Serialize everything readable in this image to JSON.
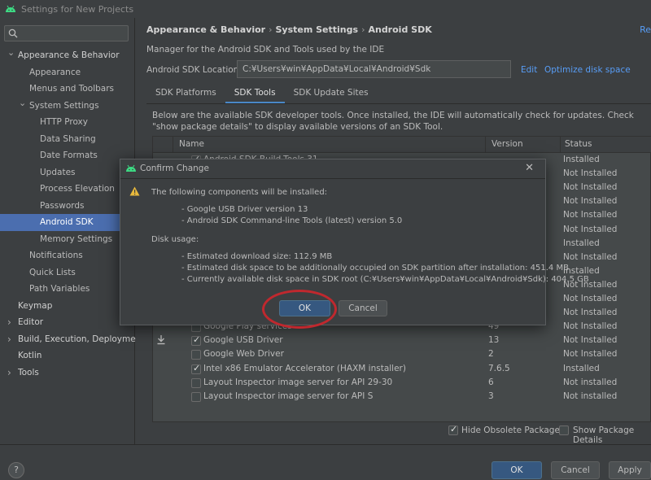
{
  "window": {
    "title": "Settings for New Projects"
  },
  "sidebar": {
    "search_placeholder": "",
    "items": [
      {
        "label": "Appearance & Behavior",
        "expanded": true
      },
      {
        "label": "Appearance"
      },
      {
        "label": "Menus and Toolbars"
      },
      {
        "label": "System Settings",
        "expanded": true
      },
      {
        "label": "HTTP Proxy"
      },
      {
        "label": "Data Sharing"
      },
      {
        "label": "Date Formats"
      },
      {
        "label": "Updates"
      },
      {
        "label": "Process Elevation"
      },
      {
        "label": "Passwords"
      },
      {
        "label": "Android SDK",
        "selected": true
      },
      {
        "label": "Memory Settings"
      },
      {
        "label": "Notifications"
      },
      {
        "label": "Quick Lists"
      },
      {
        "label": "Path Variables"
      },
      {
        "label": "Keymap"
      },
      {
        "label": "Editor",
        "expanded": false
      },
      {
        "label": "Build, Execution, Deployment",
        "expanded": false
      },
      {
        "label": "Kotlin"
      },
      {
        "label": "Tools",
        "expanded": false
      }
    ]
  },
  "main": {
    "breadcrumb": [
      "Appearance & Behavior",
      "System Settings",
      "Android SDK"
    ],
    "breadcrumb_sep": "›",
    "reset_label": "Re",
    "manager_text": "Manager for the Android SDK and Tools used by the IDE",
    "location_label": "Android SDK Location:",
    "location_value": "C:¥Users¥win¥AppData¥Local¥Android¥Sdk",
    "edit_label": "Edit",
    "optimize_label": "Optimize disk space",
    "tabs": [
      {
        "label": "SDK Platforms"
      },
      {
        "label": "SDK Tools",
        "active": true
      },
      {
        "label": "SDK Update Sites"
      }
    ],
    "description": "Below are the available SDK developer tools. Once installed, the IDE will automatically check for updates. Check \"show package details\" to display available versions of an SDK Tool.",
    "table": {
      "headers": {
        "name": "Name",
        "version": "Version",
        "status": "Status"
      },
      "hidden_rows_status": [
        "Installed",
        "Not Installed",
        "Not Installed",
        "Not Installed",
        "Not Installed",
        "Not Installed",
        "Installed",
        "Not Installed",
        "Installed",
        "Not Installed",
        "Not Installed",
        "Not Installed"
      ],
      "rows": [
        {
          "name": "Google Play services",
          "version": "49",
          "status": "Not Installed",
          "checked": false
        },
        {
          "name": "Google USB Driver",
          "version": "13",
          "status": "Not Installed",
          "checked": true,
          "download": true
        },
        {
          "name": "Google Web Driver",
          "version": "2",
          "status": "Not Installed",
          "checked": false
        },
        {
          "name": "Intel x86 Emulator Accelerator (HAXM installer)",
          "version": "7.6.5",
          "status": "Installed",
          "checked": true
        },
        {
          "name": "Layout Inspector image server for API 29-30",
          "version": "6",
          "status": "Not installed",
          "checked": false
        },
        {
          "name": "Layout Inspector image server for API S",
          "version": "3",
          "status": "Not installed",
          "checked": false
        }
      ],
      "first_row_partial_name": "Android SDK Build-Tools 31"
    },
    "hide_obsolete_label": "Hide Obsolete Packages",
    "hide_obsolete_checked": true,
    "show_details_label": "Show Package Details",
    "show_details_checked": false
  },
  "footer": {
    "help_label": "?",
    "ok_label": "OK",
    "cancel_label": "Cancel",
    "apply_label": "Apply"
  },
  "dialog": {
    "title": "Confirm Change",
    "intro": "The following components will be installed:",
    "components": [
      "- Google USB Driver version 13",
      "- Android SDK Command-line Tools (latest) version 5.0"
    ],
    "disk_usage_label": "Disk usage:",
    "disk_lines": [
      "- Estimated download size: 112.9 MB",
      "- Estimated disk space to be additionally occupied on SDK partition after installation: 451.4 MB",
      "- Currently available disk space in SDK root (C:¥Users¥win¥AppData¥Local¥Android¥Sdk): 404.5 GB"
    ],
    "ok_label": "OK",
    "cancel_label": "Cancel",
    "close_glyph": "✕"
  },
  "colors": {
    "accent": "#4b6eaf",
    "link": "#589df6",
    "highlight_ring": "#c0282e",
    "android_green": "#3ddc84"
  }
}
